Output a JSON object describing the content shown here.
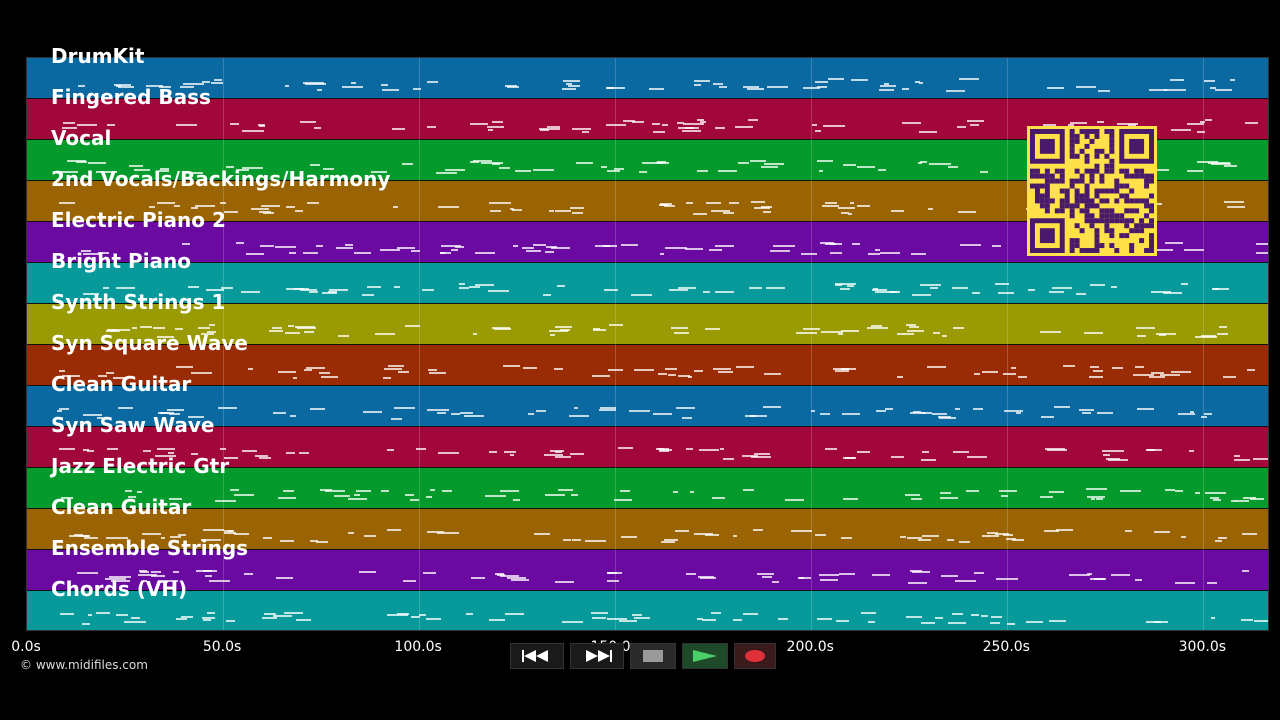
{
  "tracks": [
    {
      "name": "DrumKit",
      "color": "#0a69a0"
    },
    {
      "name": "Fingered Bass",
      "color": "#a1073a"
    },
    {
      "name": "Vocal",
      "color": "#059a2c"
    },
    {
      "name": "2nd Vocals/Backings/Harmony",
      "color": "#9a6405"
    },
    {
      "name": "Electric Piano 2",
      "color": "#6a0aa0"
    },
    {
      "name": "Bright Piano",
      "color": "#089a9a"
    },
    {
      "name": "Synth Strings 1",
      "color": "#9a9a05"
    },
    {
      "name": "Syn Square Wave",
      "color": "#9a2c05"
    },
    {
      "name": "Clean Guitar",
      "color": "#0a69a0"
    },
    {
      "name": "Syn Saw Wave",
      "color": "#a1073a"
    },
    {
      "name": "Jazz Electric Gtr",
      "color": "#059a2c"
    },
    {
      "name": "Clean Guitar",
      "color": "#9a6405"
    },
    {
      "name": "Ensemble Strings",
      "color": "#6a0aa0"
    },
    {
      "name": "Chords (VH)",
      "color": "#089a9a"
    }
  ],
  "time_axis": {
    "ticks": [
      "0.0s",
      "50.0s",
      "100.0s",
      "150.0s",
      "200.0s",
      "250.0s",
      "300.0s"
    ],
    "tick_values": [
      0,
      50,
      100,
      150,
      200,
      250,
      300
    ],
    "max": 317
  },
  "copyright": "© www.midifiles.com",
  "controls": {
    "rewind": "rewind-icon",
    "fast_forward": "fast-forward-icon",
    "stop": "stop-icon",
    "play": "play-icon",
    "record": "record-icon"
  },
  "qr_color": "#ffe14a"
}
